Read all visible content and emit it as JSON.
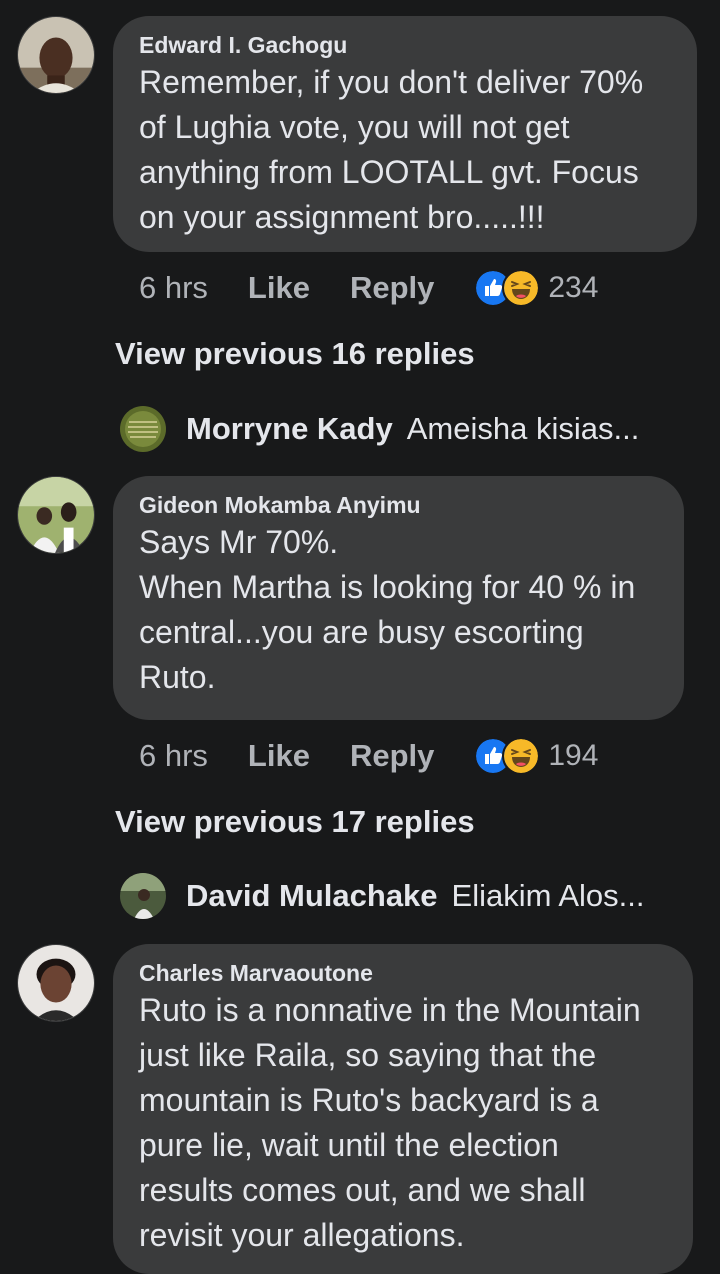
{
  "colors": {
    "background": "#18191a",
    "bubble": "#3a3b3c",
    "text_primary": "#e4e6eb",
    "text_secondary": "#b0b3b8",
    "like_blue": "#1877f2",
    "haha_yellow": "#f7b928"
  },
  "comments": [
    {
      "author": "Edward I. Gachogu",
      "text": "Remember,  if you don't deliver 70%\nof Lughia vote, you will  not get\nanything from LOOTALL gvt. Focus\non your assignment bro.....!!!",
      "time": "6 hrs",
      "like_label": "Like",
      "reply_label": "Reply",
      "reaction_icons": [
        "like-icon",
        "haha-icon"
      ],
      "reaction_count": "234",
      "view_previous": "View previous 16 replies",
      "latest_reply": {
        "name": "Morryne Kady",
        "snippet": "Ameisha kisias..."
      }
    },
    {
      "author": "Gideon Mokamba Anyimu",
      "text": "Says Mr 70%.\nWhen Martha is looking for 40 % in\ncentral...you are busy escorting\nRuto.",
      "time": "6 hrs",
      "like_label": "Like",
      "reply_label": "Reply",
      "reaction_icons": [
        "like-icon",
        "haha-icon"
      ],
      "reaction_count": "194",
      "view_previous": "View previous 17 replies",
      "latest_reply": {
        "name": "David Mulachake",
        "snippet": "Eliakim Alos..."
      }
    },
    {
      "author": "Charles Marvaoutone",
      "text": "Ruto is a nonnative in the Mountain\njust like Raila, so saying that the\nmountain is Ruto's backyard is a\npure lie, wait until the election\nresults comes out, and we shall\nrevisit your allegations."
    }
  ]
}
